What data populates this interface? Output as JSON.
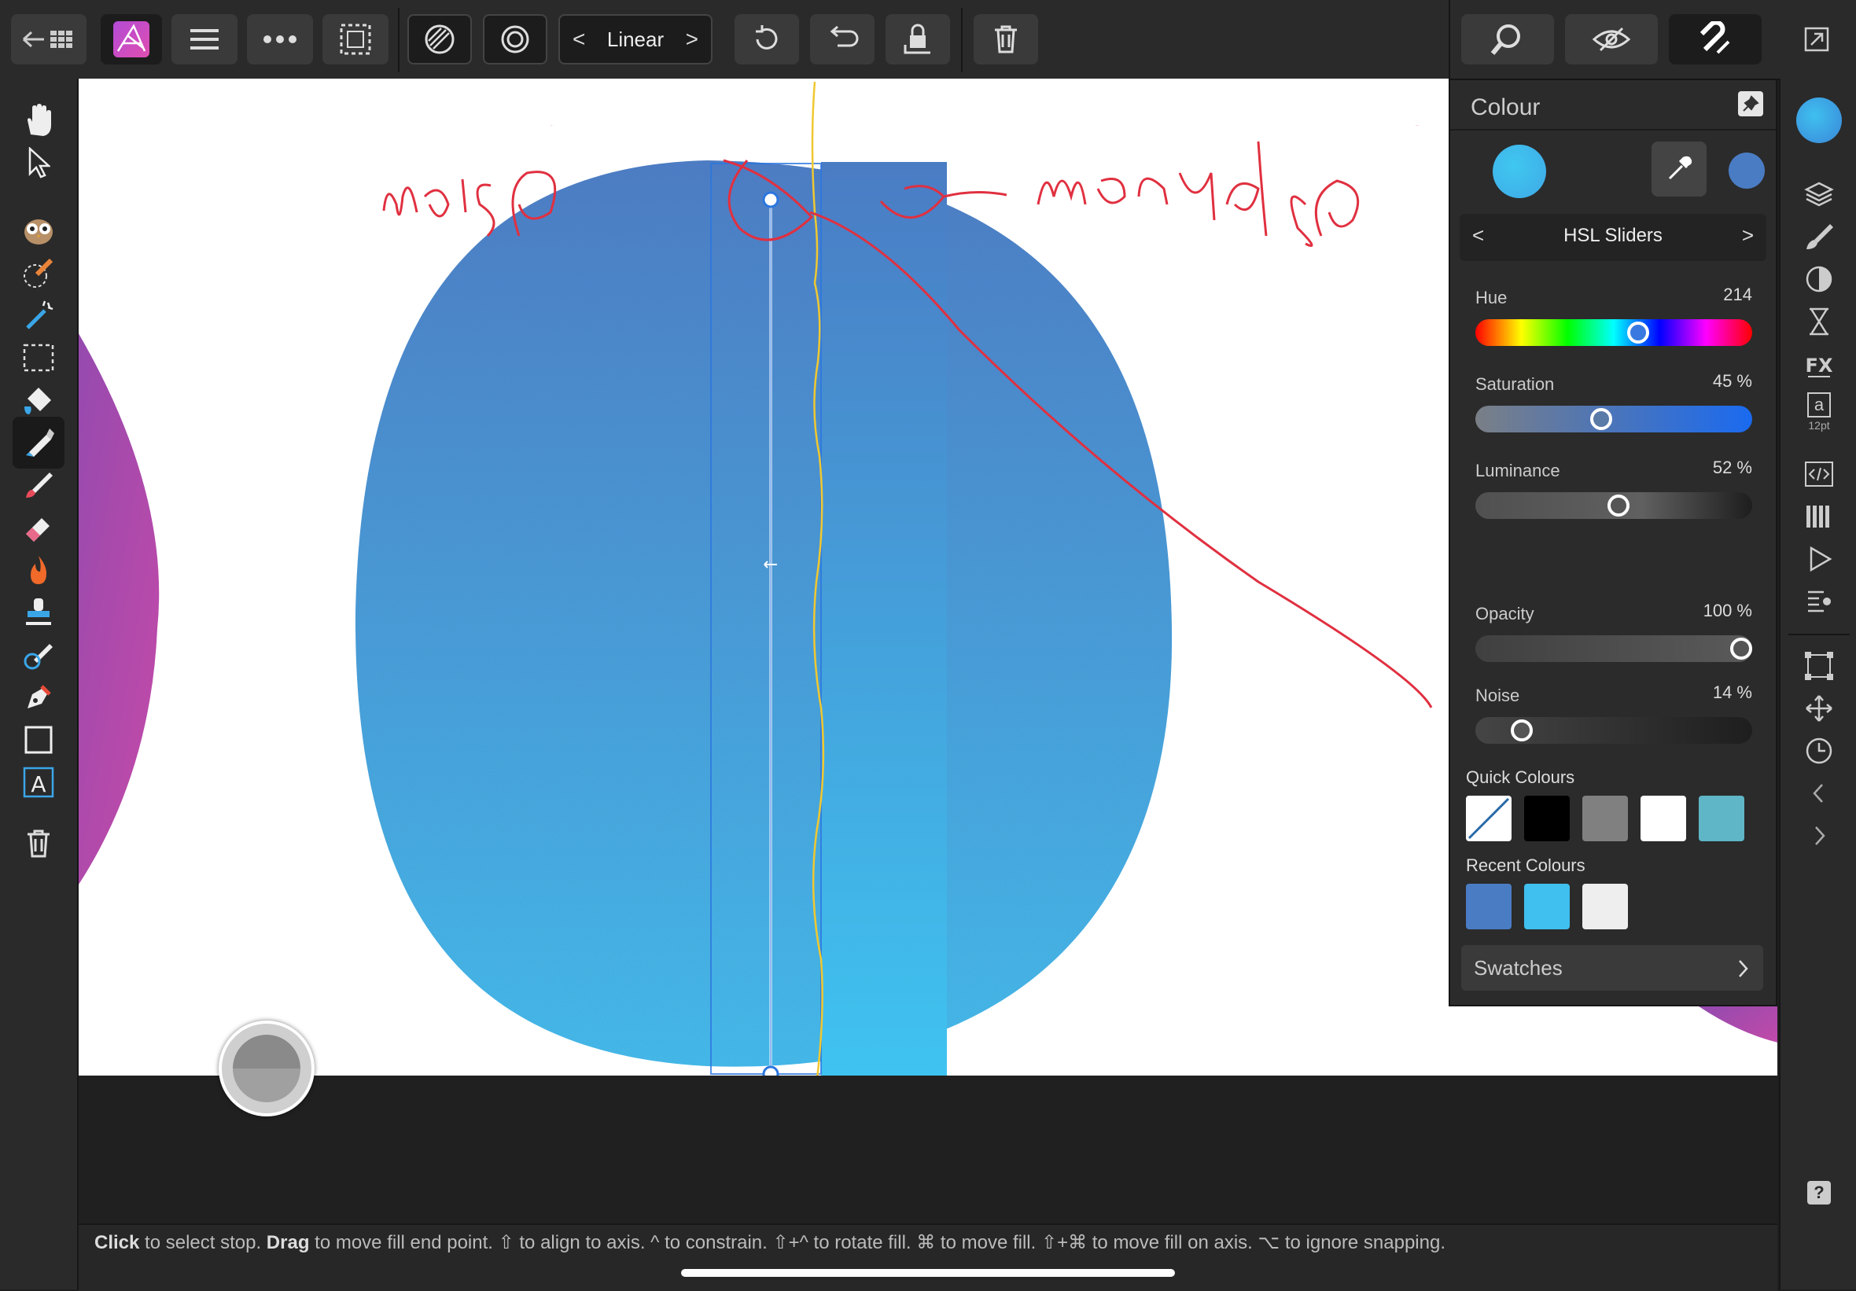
{
  "toolbar": {
    "gradient_type": "Linear",
    "prev_arrow": "<",
    "next_arrow": ">"
  },
  "colour_panel": {
    "title": "Colour",
    "mode": "HSL Sliders",
    "prev_arrow": "<",
    "next_arrow": ">",
    "sliders": {
      "hue": {
        "label": "Hue",
        "value": "214",
        "level": 214,
        "max": 360
      },
      "saturation": {
        "label": "Saturation",
        "value": "45 %",
        "level": 45,
        "max": 100
      },
      "luminance": {
        "label": "Luminance",
        "value": "52 %",
        "level": 52,
        "max": 100
      },
      "opacity": {
        "label": "Opacity",
        "value": "100 %",
        "level": 100,
        "max": 100
      },
      "noise": {
        "label": "Noise",
        "value": "14 %",
        "level": 14,
        "max": 100
      }
    },
    "quick_colours_label": "Quick Colours",
    "quick_colours": [
      "none",
      "#000000",
      "#808080",
      "#ffffff",
      "#5fb6c6"
    ],
    "recent_colours_label": "Recent Colours",
    "recent_colours": [
      "#4a7cc4",
      "#3fc0ef",
      "#eeeeee"
    ],
    "swatches_label": "Swatches",
    "primary_colour": "#4a7cc4",
    "secondary_colour": "#3fa8e6"
  },
  "right_tools": {
    "font_size_label": "12pt",
    "text_style_glyph": "a",
    "help_glyph": "?"
  },
  "canvas": {
    "annotation_left": "noise",
    "annotation_right": "monolse"
  },
  "status": {
    "click_word": "Click",
    "click_rest": " to select stop. ",
    "drag_word": "Drag",
    "drag_rest": " to move fill end point. ⇧ to align to axis. ^ to constrain. ⇧+^ to rotate fill. ⌘ to move fill. ⇧+⌘ to move fill on axis. ⌥ to ignore snapping."
  }
}
